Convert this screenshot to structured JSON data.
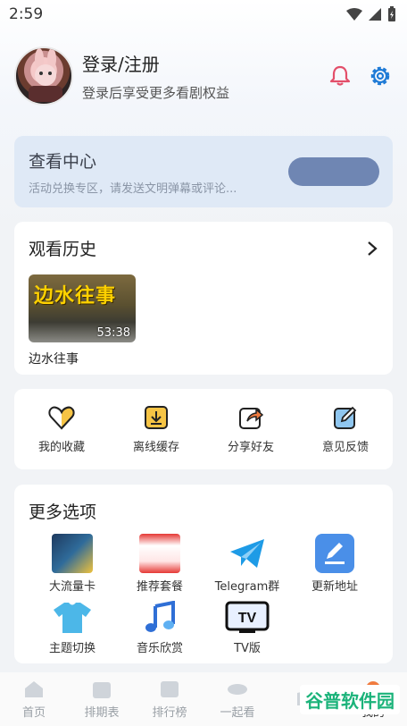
{
  "status": {
    "time": "2:59"
  },
  "profile": {
    "title": "登录/注册",
    "subtitle": "登录后享受更多看剧权益"
  },
  "center": {
    "title": "查看中心",
    "subtitle": "活动兑换专区，请发送文明弹幕或评论..."
  },
  "history": {
    "title": "观看历史",
    "item": {
      "title": "边水往事",
      "duration": "53:38",
      "poster_text": "边水往事"
    }
  },
  "actions": [
    {
      "label": "我的收藏",
      "icon": "heart-icon"
    },
    {
      "label": "离线缓存",
      "icon": "download-icon"
    },
    {
      "label": "分享好友",
      "icon": "share-icon"
    },
    {
      "label": "意见反馈",
      "icon": "feedback-icon"
    }
  ],
  "more": {
    "title": "更多选项",
    "items": [
      {
        "label": "大流量卡",
        "icon": "data-card-icon"
      },
      {
        "label": "推荐套餐",
        "icon": "package-icon"
      },
      {
        "label": "Telegram群",
        "icon": "telegram-icon"
      },
      {
        "label": "更新地址",
        "icon": "update-icon"
      },
      {
        "label": "主题切换",
        "icon": "tshirt-icon"
      },
      {
        "label": "音乐欣赏",
        "icon": "music-icon"
      },
      {
        "label": "TV版",
        "icon": "tv-icon"
      }
    ]
  },
  "tabs": [
    {
      "label": "首页"
    },
    {
      "label": "排期表"
    },
    {
      "label": "排行榜"
    },
    {
      "label": "一起看"
    },
    {
      "label": ""
    },
    {
      "label": "我的"
    }
  ],
  "watermark": {
    "text": "谷普软件园"
  },
  "colors": {
    "accent": "#1f7bd6",
    "center_bg": "#dfe9f6",
    "center_btn": "#6f86b3",
    "bell": "#e34f6a"
  }
}
